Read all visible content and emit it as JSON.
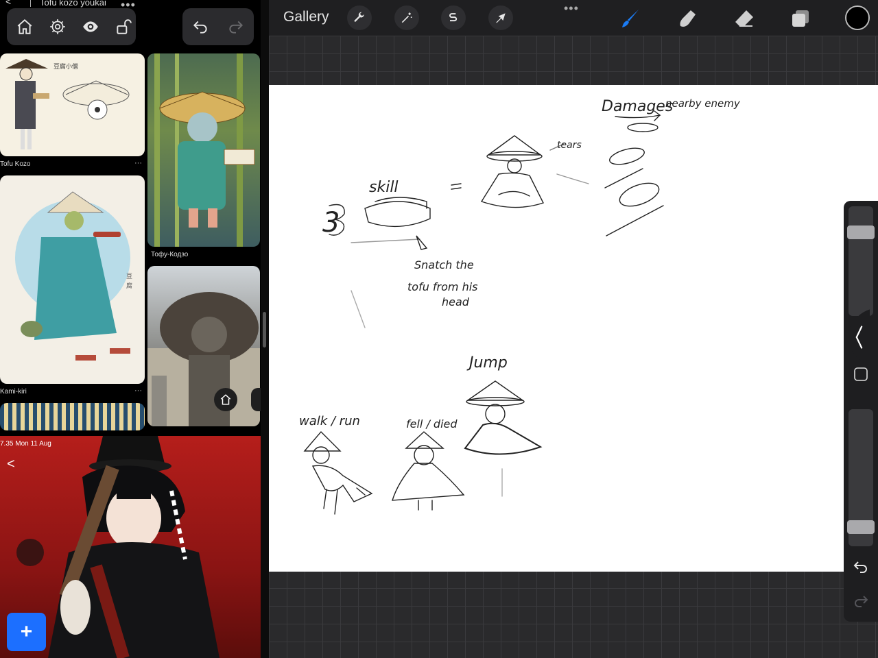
{
  "browser": {
    "search_query": "Tofu kozo youkai",
    "back_glyph": "<",
    "more_glyph": "•••"
  },
  "pins": [
    {
      "caption": "Tofu Kozo",
      "more": "···"
    },
    {
      "caption": "Тофу-Кодзо",
      "more": ""
    },
    {
      "caption": "Kami-kiri",
      "more": "···"
    }
  ],
  "bottom_app": {
    "status_time": "7.35   Mon 11 Aug",
    "back_glyph": "<",
    "fab_label": "+"
  },
  "procreate": {
    "gallery_label": "Gallery",
    "more_glyph": "•••",
    "tools_left": [
      "wrench-icon",
      "magic-wand-icon",
      "selection-s-icon",
      "transform-arrow-icon"
    ],
    "tools_right": [
      "brush-icon",
      "smudge-icon",
      "eraser-icon",
      "layers-icon"
    ],
    "brush_color": "#1b7cf5",
    "current_color": "#000000",
    "sidebar": {
      "brush_size_level": 0.8,
      "opacity_level": 0.1
    }
  },
  "canvas_notes": {
    "damages": "Damages",
    "nearby_enemy": "nearby enemy",
    "tears": "tears",
    "skill": "skill",
    "three": "3",
    "snatch_line1": "Snatch the",
    "snatch_line2": "tofu from his",
    "snatch_line3": "head",
    "jump": "Jump",
    "walk_run": "walk / run",
    "fell_died": "fell / died"
  }
}
